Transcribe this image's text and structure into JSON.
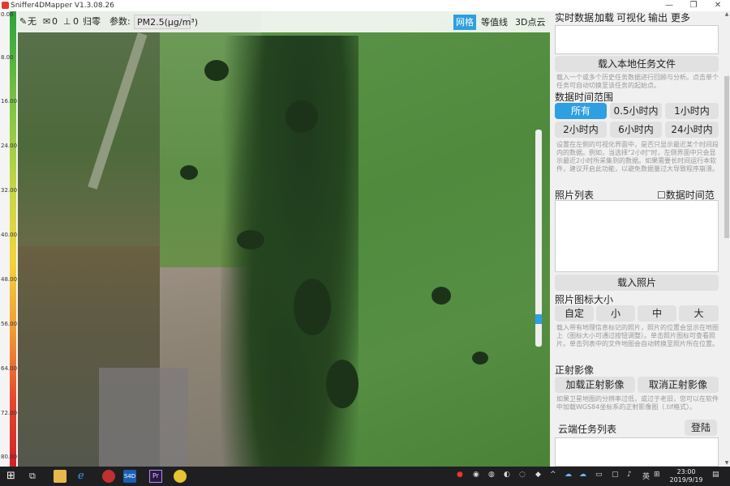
{
  "window": {
    "title": "Sniffer4DMapper V1.3.08.26",
    "min_glyph": "—",
    "max_glyph": "❐",
    "close_glyph": "✕"
  },
  "scale": {
    "ticks": [
      "0.00",
      "8.00",
      "16.00",
      "24.00",
      "32.00",
      "40.00",
      "48.00",
      "56.00",
      "64.00",
      "72.00",
      "80.00"
    ]
  },
  "map_toolbar": {
    "wind_label": "无",
    "mail_count": "0",
    "doc_count": "0",
    "reset_label": "归零",
    "param_label": "参数:",
    "param_value": "PM2.5(μg/m³)",
    "grid_label": "网格",
    "contour_label": "等值线",
    "cloud3d_label": "3D点云"
  },
  "panel": {
    "tabs": [
      "实时数据",
      "加载",
      "可视化",
      "输出",
      "更多"
    ],
    "load_task_button": "载入本地任务文件",
    "load_task_desc": "载入一个或多个历史任务数据进行回顾与分析。点击单个任务可自动切换至该任务的起始点。",
    "time_range_title": "数据时间范围",
    "time_buttons": [
      "所有",
      "0.5小时内",
      "1小时内",
      "2小时内",
      "6小时内",
      "24小时内"
    ],
    "time_selected": "所有",
    "time_desc": "设置在左侧的可视化界面中，是否只显示最近某个时间段内的数据。例如，当选择\"2小时\"时，左侧界面中只会显示最近2小时所采集到的数据。如果需要长时间运行本软件，建议开启此功能，以避免数据量过大导致程序崩溃。",
    "photo_list_title": "照片列表",
    "photo_time_checkbox": "数据时间范围",
    "load_photo_button": "载入照片",
    "photo_icon_size_title": "照片图标大小",
    "icon_size_buttons": [
      "自定",
      "小",
      "中",
      "大"
    ],
    "photo_desc": "载入带有地理信息标记的照片，照片的位置会显示在地图上（图标大小可通过按钮调整）。单击照片图标可查看照片。单击列表中的文件地图会自动转换至照片所在位置。",
    "ortho_title": "正射影像",
    "load_ortho_button": "加载正射影像",
    "cancel_ortho_button": "取消正射影像",
    "ortho_desc": "如果卫星地图的分辨率过低，或过于老旧，您可以在软件中加载WGS84坐标系的正射影像图（.tif格式）。",
    "cloud_task_title": "云端任务列表",
    "login_button": "登陆"
  },
  "taskbar": {
    "time": "23:00",
    "date": "2019/9/19",
    "ime_label": "英"
  },
  "colors": {
    "accent": "#2e9fe0",
    "taskbar": "#1f1f22"
  }
}
